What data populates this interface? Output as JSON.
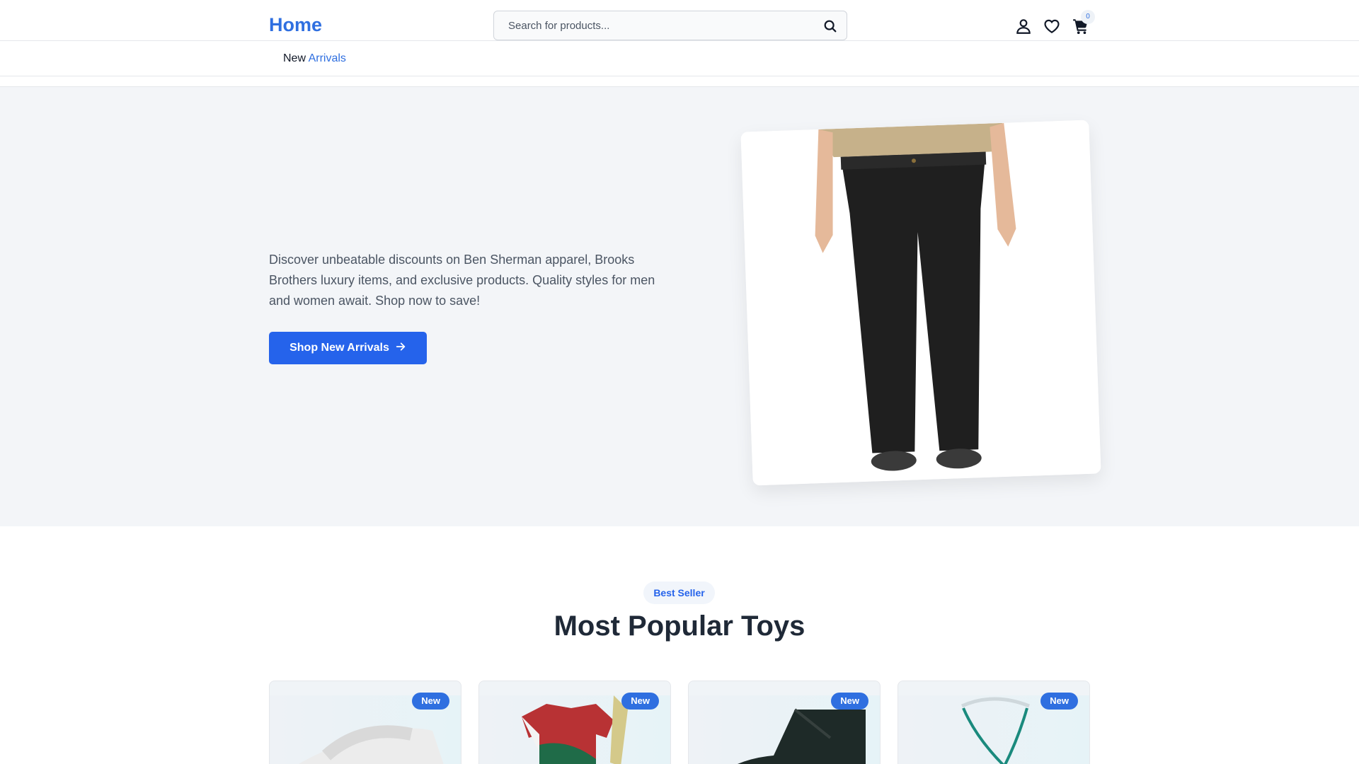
{
  "header": {
    "logo": "Home",
    "search_placeholder": "Search for products...",
    "icons": [
      "user-icon",
      "heart-icon",
      "cart-icon"
    ],
    "cart_count": "0"
  },
  "nav": {
    "link_prefix": "New",
    "link_accent": "Arrivals"
  },
  "hero": {
    "description": "Discover unbeatable discounts on Ben Sherman apparel, Brooks Brothers luxury items, and exclusive products. Quality styles for men and women await. Shop now to save!",
    "cta_label": "Shop New Arrivals"
  },
  "section": {
    "pill": "Best Seller",
    "title": "Most Popular Toys"
  },
  "products": [
    {
      "badge": "New",
      "image": "white-sandal"
    },
    {
      "badge": "New",
      "image": "portugal-jersey-chain"
    },
    {
      "badge": "New",
      "image": "black-chukka-boot"
    },
    {
      "badge": "New",
      "image": "eyeglass-strap"
    }
  ],
  "colors": {
    "accent": "#2563eb",
    "logo": "#2f6fe0",
    "hero_bg": "#f3f5f8"
  }
}
